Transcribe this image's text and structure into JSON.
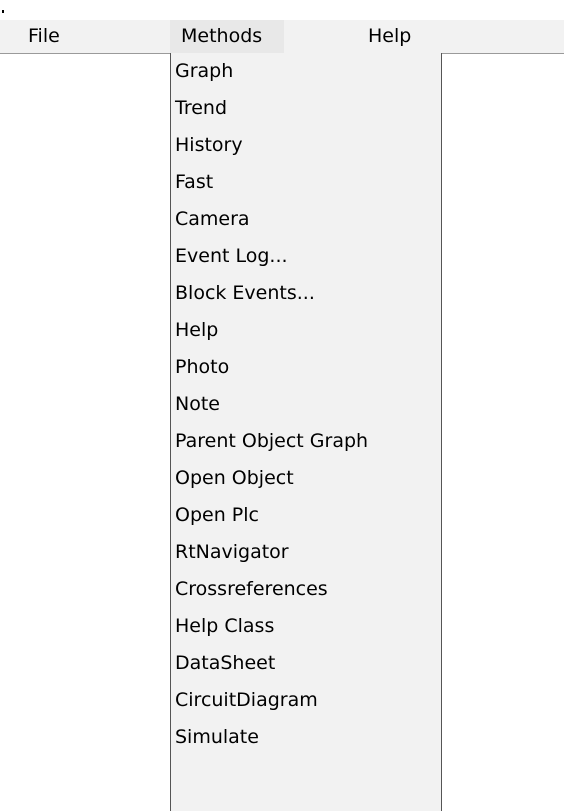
{
  "menubar": {
    "file_label": "File",
    "methods_label": "Methods",
    "help_label": "Help"
  },
  "methods_menu": {
    "items": [
      "Graph",
      "Trend",
      "History",
      "Fast",
      "Camera",
      "Event Log...",
      "Block Events...",
      "Help",
      "Photo",
      "Note",
      "Parent Object Graph",
      "Open Object",
      "Open Plc",
      "RtNavigator",
      "Crossreferences",
      "Help Class",
      "DataSheet",
      "CircuitDiagram",
      "Simulate"
    ]
  },
  "colors": {
    "menubar_bg": "#f2f2f2",
    "active_menu_bg": "#e8e8e8",
    "dropdown_bg": "#f2f2f2",
    "text": "#000000"
  }
}
